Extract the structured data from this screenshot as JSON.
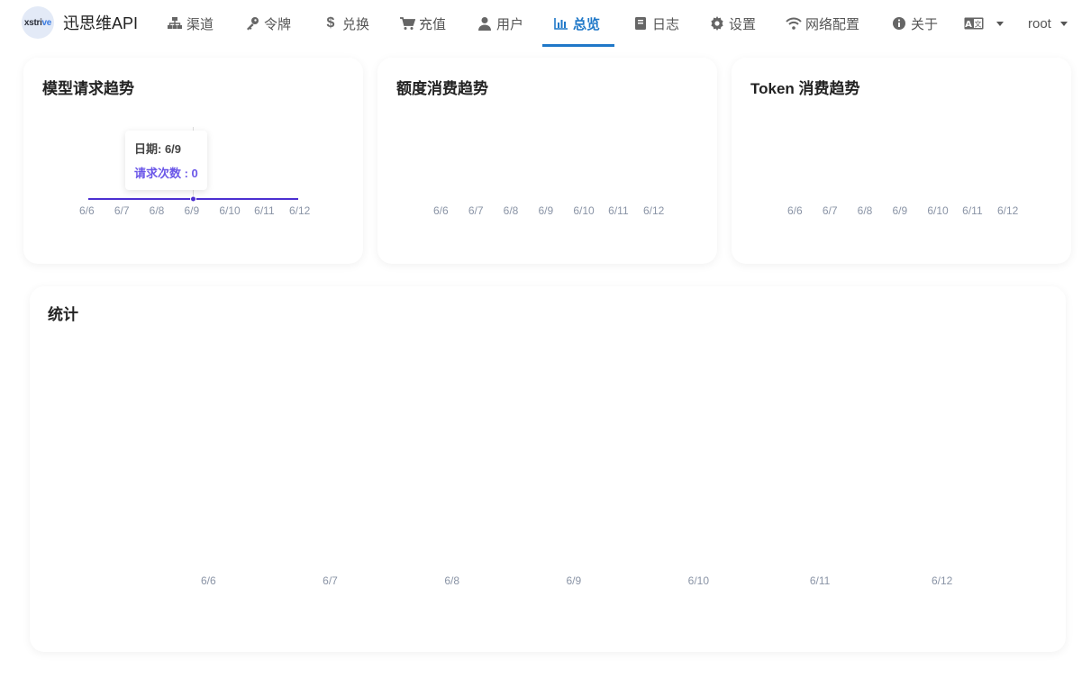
{
  "brand": {
    "logo_text": "xstri",
    "logo_accent": "ve",
    "name": "迅思维API"
  },
  "nav": {
    "items": [
      {
        "label": "渠道",
        "icon": "sitemap-icon"
      },
      {
        "label": "令牌",
        "icon": "key-icon"
      },
      {
        "label": "兑换",
        "icon": "dollar-icon"
      },
      {
        "label": "充值",
        "icon": "cart-icon"
      },
      {
        "label": "用户",
        "icon": "user-icon"
      },
      {
        "label": "总览",
        "icon": "bar-chart-icon",
        "active": true
      },
      {
        "label": "日志",
        "icon": "book-icon"
      },
      {
        "label": "设置",
        "icon": "gear-icon"
      },
      {
        "label": "网络配置",
        "icon": "wifi-icon"
      },
      {
        "label": "关于",
        "icon": "info-icon"
      }
    ],
    "language_icon": "translate-icon",
    "user": "root"
  },
  "colors": {
    "accent": "#1f78c8",
    "request": "#4c2fd1",
    "quota": "#19b3c9",
    "token": "#7b6cf0"
  },
  "cards": {
    "requests": {
      "title": "模型请求趋势",
      "tooltip": {
        "date_label": "日期: 6/9",
        "count_label": "请求次数 : 0"
      }
    },
    "quota": {
      "title": "额度消费趋势"
    },
    "tokens": {
      "title": "Token 消费趋势"
    },
    "stats": {
      "title": "统计"
    }
  },
  "chart_data": [
    {
      "type": "line",
      "categories": [
        "6/6",
        "6/7",
        "6/8",
        "6/9",
        "6/10",
        "6/11",
        "6/12"
      ],
      "series": [
        {
          "name": "请求次数",
          "values": [
            0,
            0,
            0,
            0,
            0,
            0,
            0
          ]
        }
      ]
    },
    {
      "type": "line",
      "categories": [
        "6/6",
        "6/7",
        "6/8",
        "6/9",
        "6/10",
        "6/11",
        "6/12"
      ],
      "series": [
        {
          "values": [
            0,
            0,
            0,
            0,
            0,
            0,
            0
          ]
        }
      ]
    },
    {
      "type": "line",
      "categories": [
        "6/6",
        "6/7",
        "6/8",
        "6/9",
        "6/10",
        "6/11",
        "6/12"
      ],
      "series": [
        {
          "values": [
            0,
            0,
            0,
            0,
            0,
            0,
            0
          ]
        }
      ]
    },
    {
      "type": "bar",
      "categories": [
        "6/6",
        "6/7",
        "6/8",
        "6/9",
        "6/10",
        "6/11",
        "6/12"
      ],
      "series": []
    }
  ]
}
